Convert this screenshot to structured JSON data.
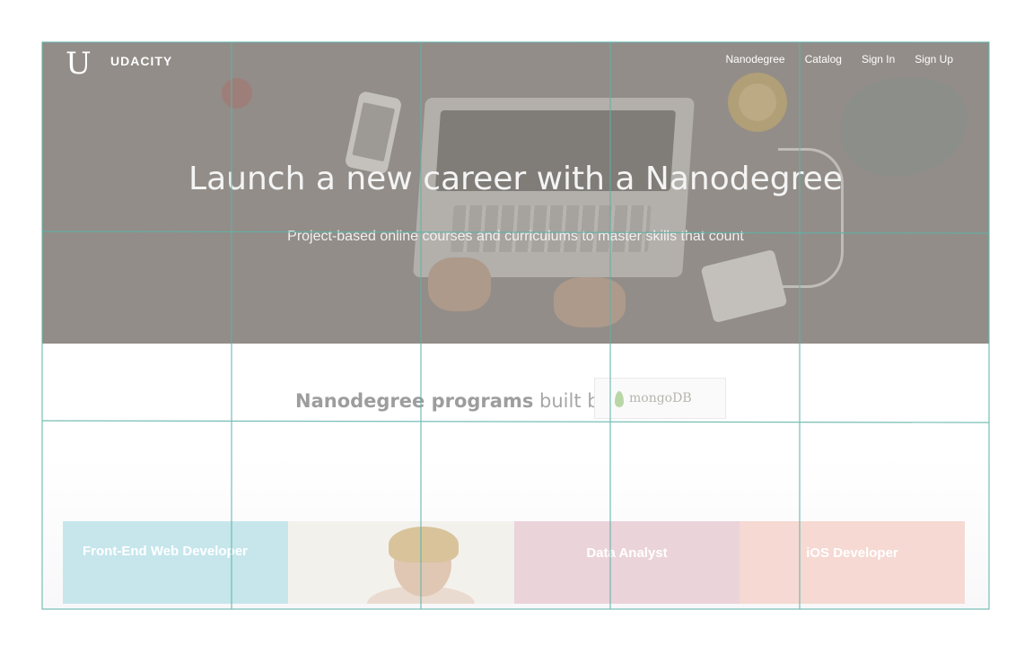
{
  "header": {
    "brand": "UDACITY",
    "logo_mark": "U",
    "nav": [
      {
        "label": "Nanodegree"
      },
      {
        "label": "Catalog"
      },
      {
        "label": "Sign In"
      },
      {
        "label": "Sign Up"
      }
    ]
  },
  "hero": {
    "title": "Launch a new career with a Nanodegree",
    "subtitle": "Project-based online courses and curriculums to master skills that count"
  },
  "partner": {
    "lead_bold": "Nanodegree programs",
    "lead_rest": " built by",
    "logo_text": "mongoDB",
    "logo_icon": "leaf-icon"
  },
  "programs": [
    {
      "label": "Front-End Web Developer",
      "color": "#c6e6ec"
    },
    {
      "label": "",
      "color": "#f3f1ec"
    },
    {
      "label": "Data Analyst",
      "color": "#ebd3da"
    },
    {
      "label": "iOS Developer",
      "color": "#f6d9d3"
    }
  ],
  "colors": {
    "grid_line": "#5fb3a8",
    "hero_text": "#ffffff"
  }
}
